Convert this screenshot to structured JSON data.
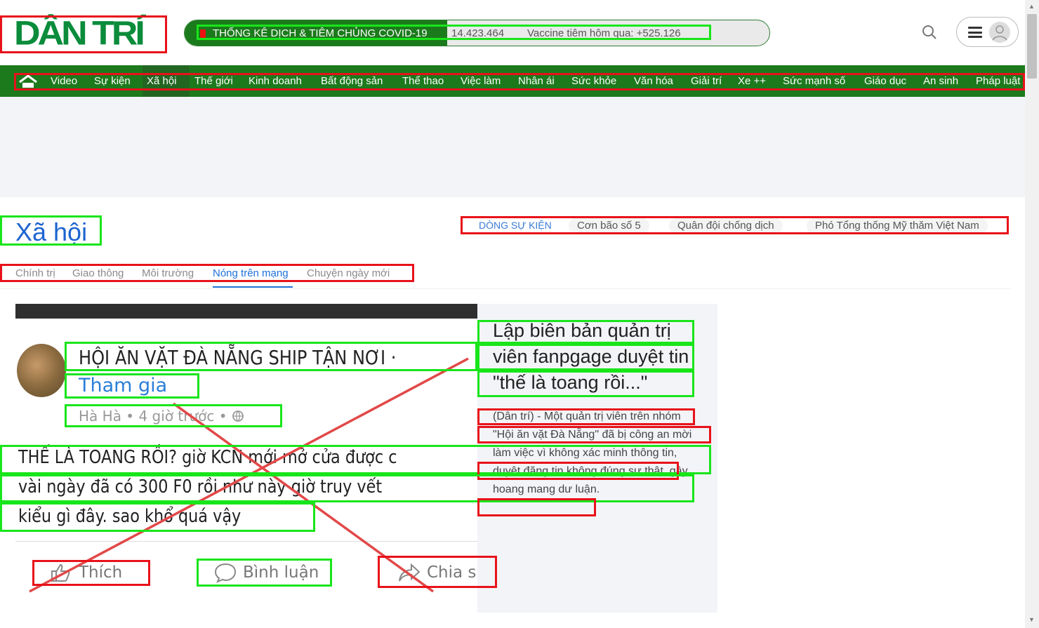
{
  "header": {
    "logo_text": "DÂN TRÍ",
    "covid_title": "THỐNG KÊ DỊCH & TIÊM CHỦNG COVID-19",
    "covid_cases": "14.423.464",
    "covid_vaccine": "Vaccine tiêm hôm qua: +525.126",
    "icons": [
      "search-icon",
      "hamburger-icon",
      "user-avatar-icon"
    ]
  },
  "nav": {
    "home_icon": "home-icon",
    "items": [
      "Video",
      "Sự kiện",
      "Xã hội",
      "Thế giới",
      "Kinh doanh",
      "Bất động sản",
      "Thể thao",
      "Việc làm",
      "Nhân ái",
      "Sức khỏe",
      "Văn hóa",
      "Giải trí",
      "Xe ++",
      "Sức mạnh số",
      "Giáo dục",
      "An sinh",
      "Pháp luật"
    ],
    "active": "Xã hội"
  },
  "section": {
    "title": "Xã hội",
    "events_label": "DÒNG SỰ KIỆN",
    "events": [
      "Cơn bão số 5",
      "Quân đội chống dịch",
      "Phó Tổng thống Mỹ thăm Việt Nam"
    ],
    "subnav": [
      "Chính trị",
      "Giao thông",
      "Môi trường",
      "Nóng trên mạng",
      "Chuyện ngày mới"
    ],
    "subnav_active": "Nóng trên mạng"
  },
  "article": {
    "image": {
      "group_name": "HỘI ĂN VẶT ĐÀ NẴNG SHIP TẬN NƠI ·",
      "join": "Tham gia",
      "meta": "Hà Hà • 4 giờ trước • ",
      "post_lines": [
        "THẾ LÀ TOANG RỒI? giờ KCN mới mở cửa được c",
        "vài ngày đã có 300 F0 rồi như này giờ truy vết",
        "kiểu gì đây. sao khổ quá vậy"
      ],
      "like": "Thích",
      "comment": "Bình luận",
      "share": "Chia s"
    },
    "title": "Lập biên bản quản trị viên fanpgage duyệt tin \"thế là toang rồi...\"",
    "description": "(Dân trí) - Một quản trị viên trên nhóm \"Hội ăn vặt Đà Nẵng\" đã bị công an mời làm việc vì không xác minh thông tin, duyệt đăng tin không đúng sự thật, gây hoang mang dư luận."
  },
  "colors": {
    "brand_green": "#1c7a1c",
    "link_blue": "#1d64d0",
    "annotation_red": "#e8121a",
    "annotation_green": "#19e51b"
  }
}
